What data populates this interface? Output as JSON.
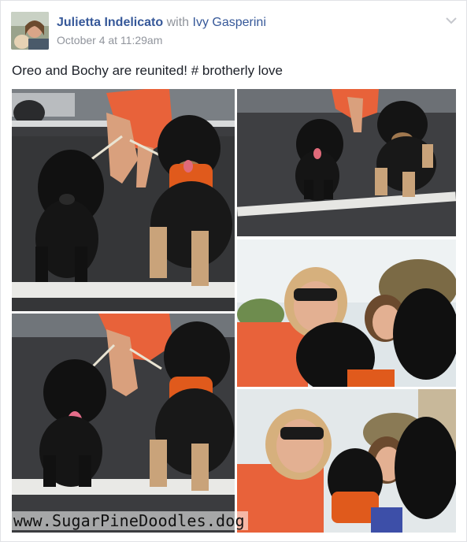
{
  "post": {
    "author": "Julietta Indelicato",
    "with_text": "with",
    "tagged_user": "Ivy Gasperini",
    "timestamp": "October 4 at 11:29am",
    "text": "Oreo and Bochy are reunited! # brotherly love"
  },
  "photos": [
    {
      "description": "two dogs on leashes in parking lot, woman in orange dress behind"
    },
    {
      "description": "two dogs standing on parking lot line"
    },
    {
      "description": "selfie of two women with black dog"
    },
    {
      "description": "black puppy tongue out with tan and black dog"
    },
    {
      "description": "selfie of two women with two dogs"
    }
  ],
  "watermark": "www.SugarPineDoodles.dog",
  "colors": {
    "link": "#365899",
    "meta": "#90949c",
    "text": "#1d2129",
    "orange_dress": "#e8623a"
  },
  "icons": {
    "menu": "chevron-down-icon"
  }
}
